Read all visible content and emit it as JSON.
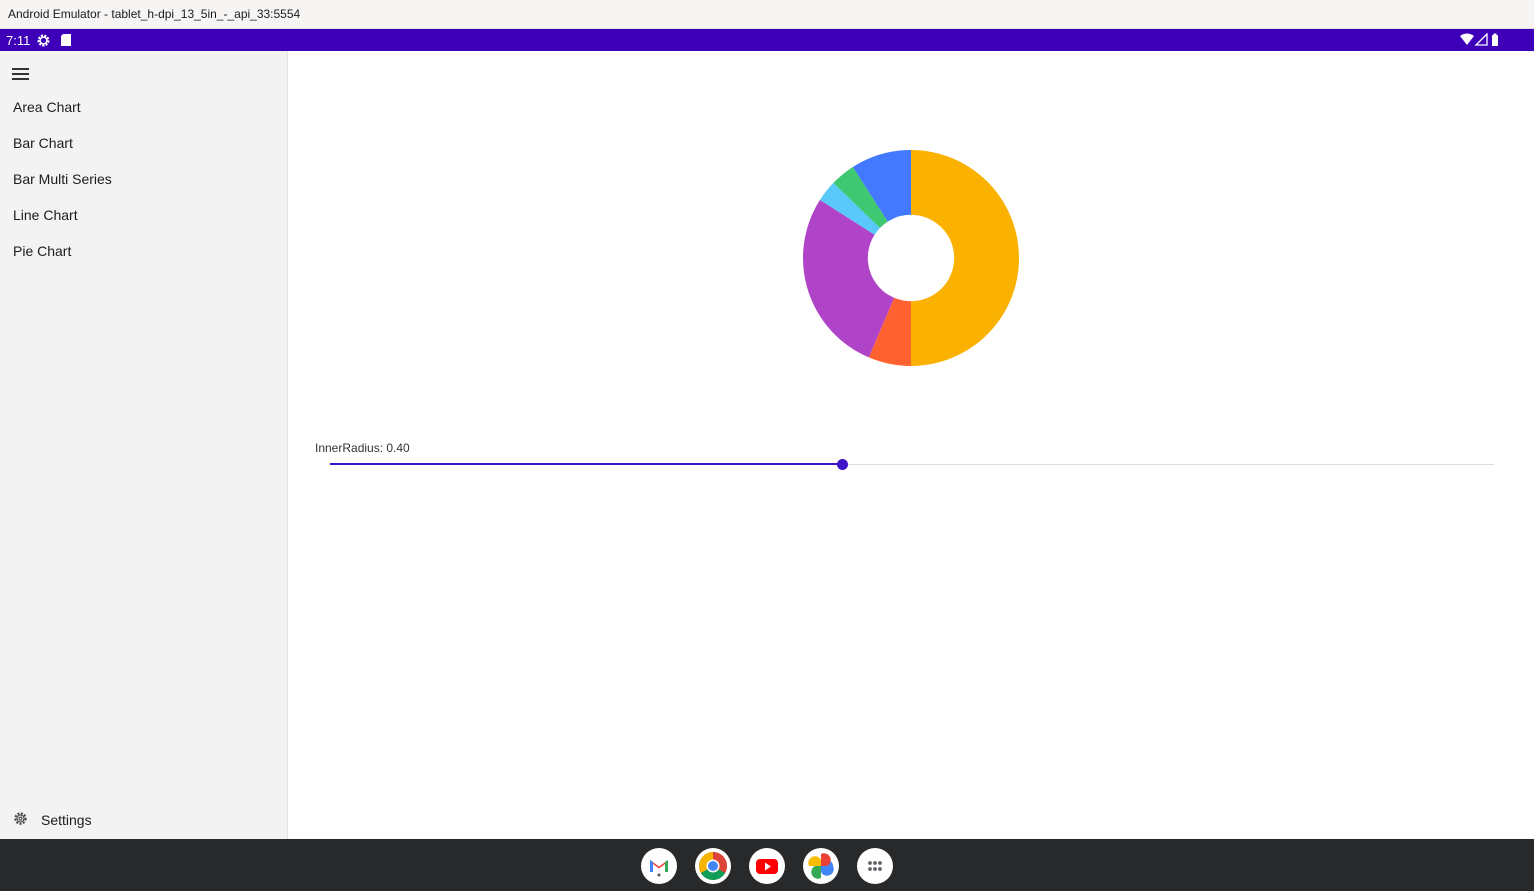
{
  "window": {
    "title": "Android Emulator - tablet_h-dpi_13_5in_-_api_33:5554"
  },
  "status_bar": {
    "time": "7:11",
    "icons": [
      "settings-gear-icon",
      "sd-card-icon",
      "wifi-icon",
      "cellular-signal-icon",
      "battery-icon"
    ]
  },
  "drawer": {
    "menu_icon": "hamburger-menu-icon",
    "items": [
      {
        "label": "Area Chart"
      },
      {
        "label": "Bar Chart"
      },
      {
        "label": "Bar Multi Series"
      },
      {
        "label": "Line Chart"
      },
      {
        "label": "Pie Chart"
      }
    ],
    "settings": {
      "label": "Settings",
      "icon": "gear-icon"
    }
  },
  "main": {
    "slider": {
      "label": "InnerRadius: 0.40",
      "value": 0.4,
      "min": 0,
      "max": 1
    }
  },
  "chart_data": {
    "type": "pie",
    "inner_radius": 0.4,
    "series": [
      {
        "value": 47,
        "color": "#fbb100"
      },
      {
        "value": 6,
        "color": "#ff6131"
      },
      {
        "value": 26,
        "color": "#b044c9"
      },
      {
        "value": 3,
        "color": "#5ac8fa"
      },
      {
        "value": 3.5,
        "color": "#3ec871"
      },
      {
        "value": 8.5,
        "color": "#4379ff"
      }
    ]
  },
  "dock": {
    "apps": [
      "gmail-icon",
      "chrome-icon",
      "youtube-icon",
      "photos-icon",
      "app-drawer-icon"
    ]
  },
  "colors": {
    "status_bar": "#3d00b8",
    "accent": "#3d13c8",
    "drawer_bg": "#f3f3f3",
    "dock_bg": "#27292b"
  }
}
